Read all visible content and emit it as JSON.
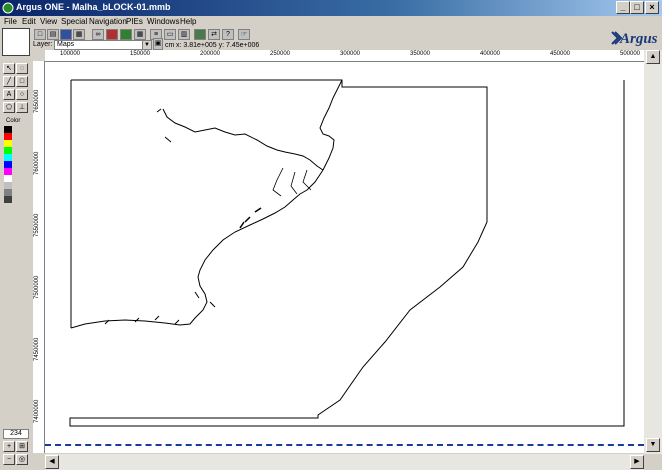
{
  "window": {
    "title": "Argus ONE - Malha_bLOCK-01.mmb"
  },
  "menu": [
    "File",
    "Edit",
    "View",
    "Special",
    "Navigation",
    "PIEs",
    "Windows",
    "Help"
  ],
  "layer": {
    "label": "Layer:",
    "value": "Maps"
  },
  "coords": {
    "unit": "cm",
    "text": "x: 3.81e+005 y: 7.45e+006"
  },
  "logo": {
    "text": "Argus"
  },
  "palette": {
    "color_label": "Color",
    "zoom_value": "234",
    "swatches": [
      "#000000",
      "#ff0000",
      "#ffff00",
      "#00ff00",
      "#00ffff",
      "#0000ff",
      "#ff00ff",
      "#ffffff",
      "#c0c0c0",
      "#808080",
      "#404040"
    ]
  },
  "ruler": {
    "h_ticks": [
      "100000",
      "150000",
      "200000",
      "250000",
      "300000",
      "350000",
      "400000",
      "450000",
      "500000"
    ],
    "v_ticks": [
      "7650000",
      "7600000",
      "7550000",
      "7500000",
      "7450000",
      "7400000"
    ]
  },
  "colors": {
    "titlebar": "#0a246a",
    "accent": "#1a3a9a"
  }
}
